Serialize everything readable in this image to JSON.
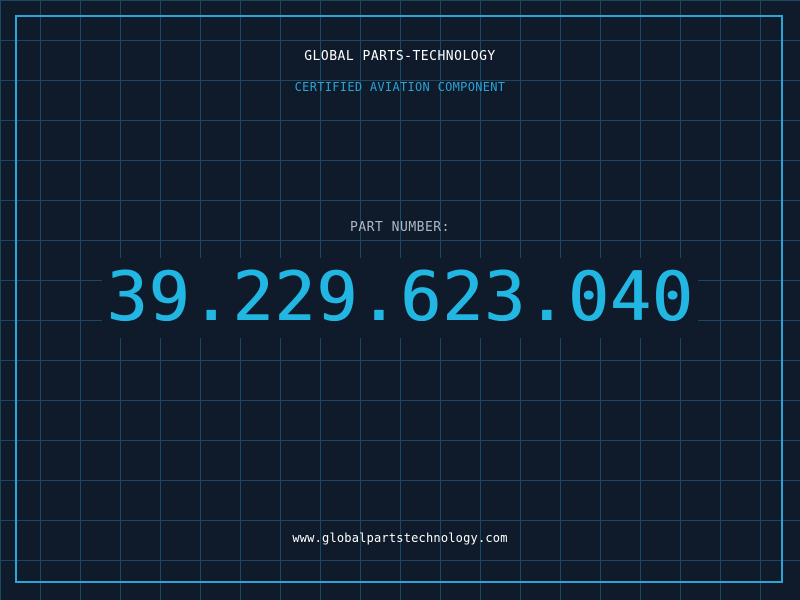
{
  "header": {
    "company": "GLOBAL PARTS-TECHNOLOGY",
    "tagline": "CERTIFIED AVIATION COMPONENT"
  },
  "part": {
    "label": "PART NUMBER:",
    "number": "39.229.623.040"
  },
  "footer": {
    "website": "www.globalpartstechnology.com"
  },
  "colors": {
    "background": "#0f1a2b",
    "grid": "#1a4a63",
    "frame": "#2aa6d6",
    "accent": "#22b7e3"
  }
}
